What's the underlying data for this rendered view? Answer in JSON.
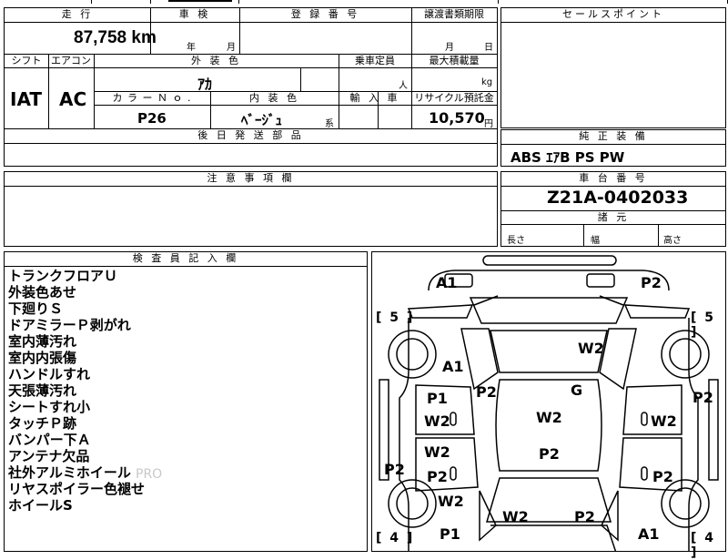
{
  "top_fragment": "",
  "summary": {
    "mileage_header": "走 行",
    "mileage_value": "87,758 km",
    "inspection_header": "車 検",
    "inspection_year_label": "年",
    "inspection_month_label": "月",
    "registration_header": "登 録 番 号",
    "transfer_deadline_header": "譲渡書類期限",
    "transfer_month_label": "月",
    "transfer_day_label": "日",
    "sales_point_header": "セールスポイント",
    "shift_header": "シフト",
    "shift_value": "IAT",
    "ac_header": "エアコン",
    "ac_value": "AC",
    "exterior_color_header": "外 装 色",
    "exterior_color_value": "ｱｶ",
    "capacity_header": "乗車定員",
    "capacity_unit": "人",
    "max_load_header": "最大積載量",
    "max_load_unit": "kg",
    "color_no_header": "カ ラ ー Ｎ ｏ .",
    "color_no_value": "P26",
    "interior_color_header": "内 装 色",
    "interior_color_value": "ﾍﾞｰｼﾞｭ",
    "interior_color_suffix": "系",
    "import_header": "輸 入 車",
    "recycle_header": "リサイクル預託金",
    "recycle_value": "10,570",
    "recycle_unit": "円",
    "later_parts_header": "後 日 発 送 部 品",
    "genuine_equipment_header": "純 正 装 備",
    "genuine_equipment_value": "ABS ｴｱB PS PW",
    "caution_header": "注 意 事 項 欄",
    "chassis_header": "車 台 番 号",
    "chassis_value": "Z21A-0402033",
    "dimensions_header": "諸 元",
    "length_label": "長さ",
    "width_label": "幅",
    "height_label": "高さ"
  },
  "inspector": {
    "header": "検 査 員 記 入 欄",
    "notes": [
      "トランクフロアＵ",
      "外装色あせ",
      "下廻りＳ",
      "ドアミラーＰ剥がれ",
      "室内薄汚れ",
      "室内内張傷",
      "ハンドルすれ",
      "天張薄汚れ",
      "シートすれ小",
      "タッチＰ跡",
      "バンパー下Ａ",
      "アンテナ欠品",
      "社外アルミホイール",
      "リヤスポイラー色褪せ",
      "ホイールS"
    ],
    "watermark": "PRO"
  },
  "diagram": {
    "tire_front_left": "[ 5 ]",
    "tire_front_right": "[ 5 ]",
    "tire_rear_left": "[ 4 ]",
    "tire_rear_right": "[ 4 ]",
    "marks": {
      "rear_bumper_left": "A1",
      "rear_bumper_right": "P2",
      "trunk": "W2",
      "rear_left_quarter": "A1",
      "rear_left_pillar": "P2",
      "rear_glass": "G",
      "right_side": "P2",
      "left_rear_door_upper": "P1",
      "left_rear_door_lower": "W2",
      "roof": "W2",
      "right_rear_door": "W2",
      "left_side": "P2",
      "left_front_door_upper": "W2",
      "left_front_door_lower": "P2",
      "front_area": "P2",
      "right_front_door": "P2",
      "left_front_fender": "W2",
      "left_front_bottom": "P1",
      "hood_left": "W2",
      "hood_right": "P2",
      "front_bumper_right": "A1"
    }
  }
}
